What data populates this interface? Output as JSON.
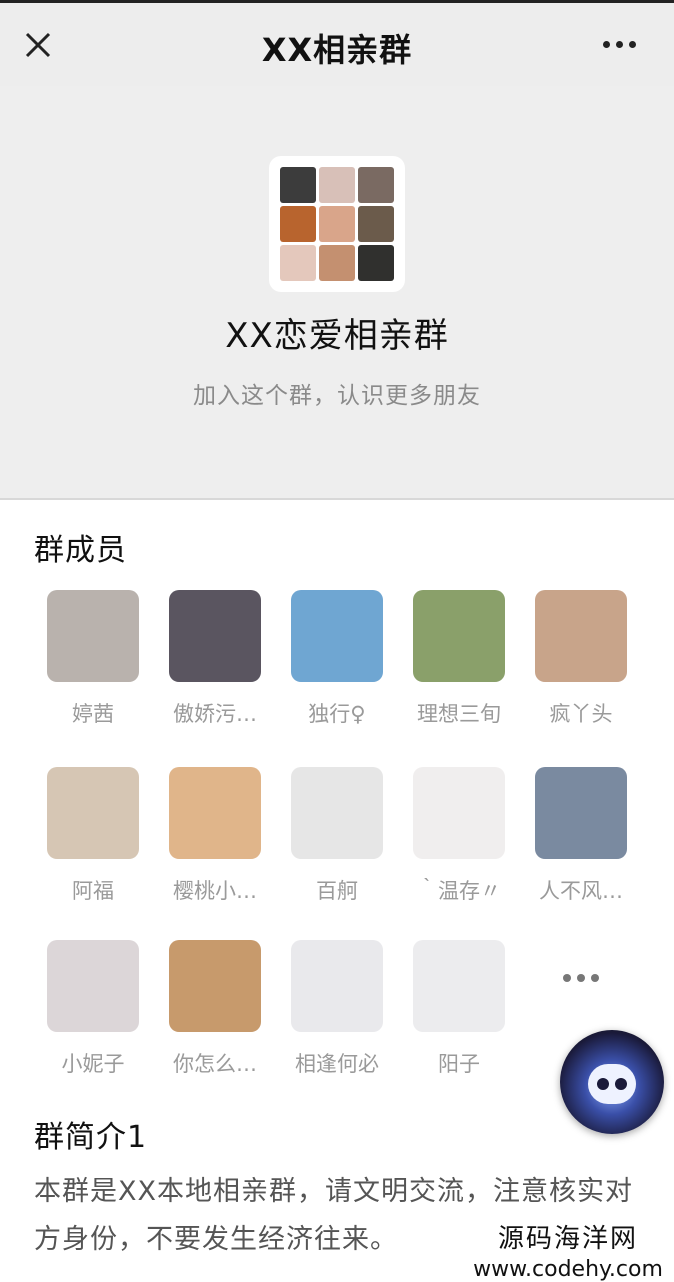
{
  "header": {
    "title": "XX相亲群",
    "close_icon": "close-icon",
    "more_icon": "more-icon"
  },
  "hero": {
    "group_name": "XX恋爱相亲群",
    "description": "加入这个群，认识更多朋友"
  },
  "members_section": {
    "title": "群成员",
    "members": [
      {
        "name": "婷茜",
        "color": "#b9b2ad"
      },
      {
        "name": "傲娇污…",
        "color": "#5a5560"
      },
      {
        "name": "独行♀",
        "color": "#6fa6d2"
      },
      {
        "name": "理想三旬",
        "color": "#8aa06a"
      },
      {
        "name": "疯丫头",
        "color": "#c8a48a"
      },
      {
        "name": "阿福",
        "color": "#d6c6b4"
      },
      {
        "name": "樱桃小…",
        "color": "#e0b58a"
      },
      {
        "name": "百舸",
        "color": "#e6e6e6"
      },
      {
        "name": "｀温存〃",
        "color": "#f0eeee"
      },
      {
        "name": "人不风…",
        "color": "#7a8aa0"
      },
      {
        "name": "小妮子",
        "color": "#dcd6d8"
      },
      {
        "name": "你怎么…",
        "color": "#c79a6c"
      },
      {
        "name": "相逢何必",
        "color": "#e9e9ec"
      },
      {
        "name": "阳子",
        "color": "#ececee"
      }
    ]
  },
  "intro": {
    "title": "群简介1",
    "text": "本群是XX本地相亲群，请文明交流，注意核实对方身份，不要发生经济往来。"
  },
  "watermark": {
    "line1": "源码海洋网",
    "line2": "www.codehy.com"
  },
  "group_avatar_colors": [
    "#3c3c3c",
    "#d8c0b8",
    "#7a6a62",
    "#b8642e",
    "#d9a58a",
    "#6b5b4b",
    "#e4c8bc",
    "#c49070",
    "#30302e"
  ]
}
